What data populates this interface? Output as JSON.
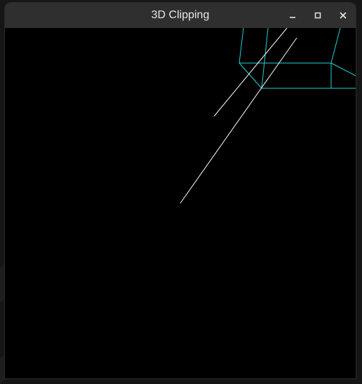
{
  "window": {
    "title": "3D Clipping",
    "controls": {
      "minimize_icon": "minimize-icon",
      "maximize_icon": "maximize-icon",
      "close_icon": "close-icon"
    }
  },
  "colors": {
    "titlebar": "#2f2f2f",
    "title_text": "#e6e6e6",
    "canvas_background": "#000000",
    "clipped_box_edges": "#22d3d8",
    "lines": "#ffffff"
  }
}
